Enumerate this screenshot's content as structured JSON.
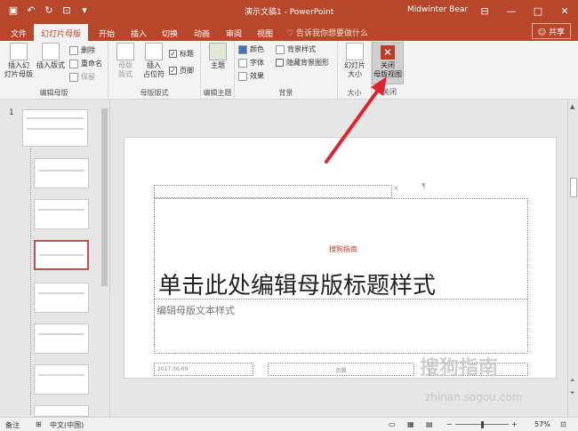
{
  "titlebar": {
    "doc_title": "演示文稿1 - PowerPoint",
    "user": "Midwinter Bear",
    "min": "—",
    "max": "□",
    "close": "✕"
  },
  "tabs": {
    "file": "文件",
    "slide_master": "幻灯片母版",
    "home": "开始",
    "insert": "插入",
    "transitions": "切换",
    "animations": "动画",
    "review": "审阅",
    "view": "视图",
    "tell_me": "告诉我你想要做什么",
    "share": "共享"
  },
  "ribbon": {
    "insert_master": "插入幻\n灯片母版",
    "insert_layout": "插入版式",
    "delete": "删除",
    "rename": "重命名",
    "preserve": "保留",
    "edit_master_label": "编辑母版",
    "master_layout": "母版\n版式",
    "insert_placeholder": "插入\n占位符",
    "title_chk": "标题",
    "footer_chk": "页脚",
    "master_layout_label": "母版版式",
    "themes": "主题",
    "edit_theme_label": "编辑主题",
    "colors": "颜色",
    "fonts": "字体",
    "effects": "效果",
    "bg_styles": "背景样式",
    "hide_bg": "隐藏背景图形",
    "background_label": "背景",
    "slide_size": "幻灯片\n大小",
    "size_label": "大小",
    "close_view": "关闭\n母版视图",
    "close_label": "关闭"
  },
  "slide_panel": {
    "first_number": "1"
  },
  "slide": {
    "title": "单击此处编辑母版标题样式",
    "subtitle": "编辑母版文本样式",
    "date": "2017.06.09",
    "footer": "页脚",
    "watermark": "搜狗指南"
  },
  "statusbar": {
    "notes": "备注",
    "language": "中文(中国)",
    "zoom": "57%"
  },
  "watermark": {
    "brand": "搜狗指南",
    "url": "zhinan.sogou.com"
  },
  "colors": {
    "accent": "#b7472a",
    "arrow": "#e0242e"
  }
}
